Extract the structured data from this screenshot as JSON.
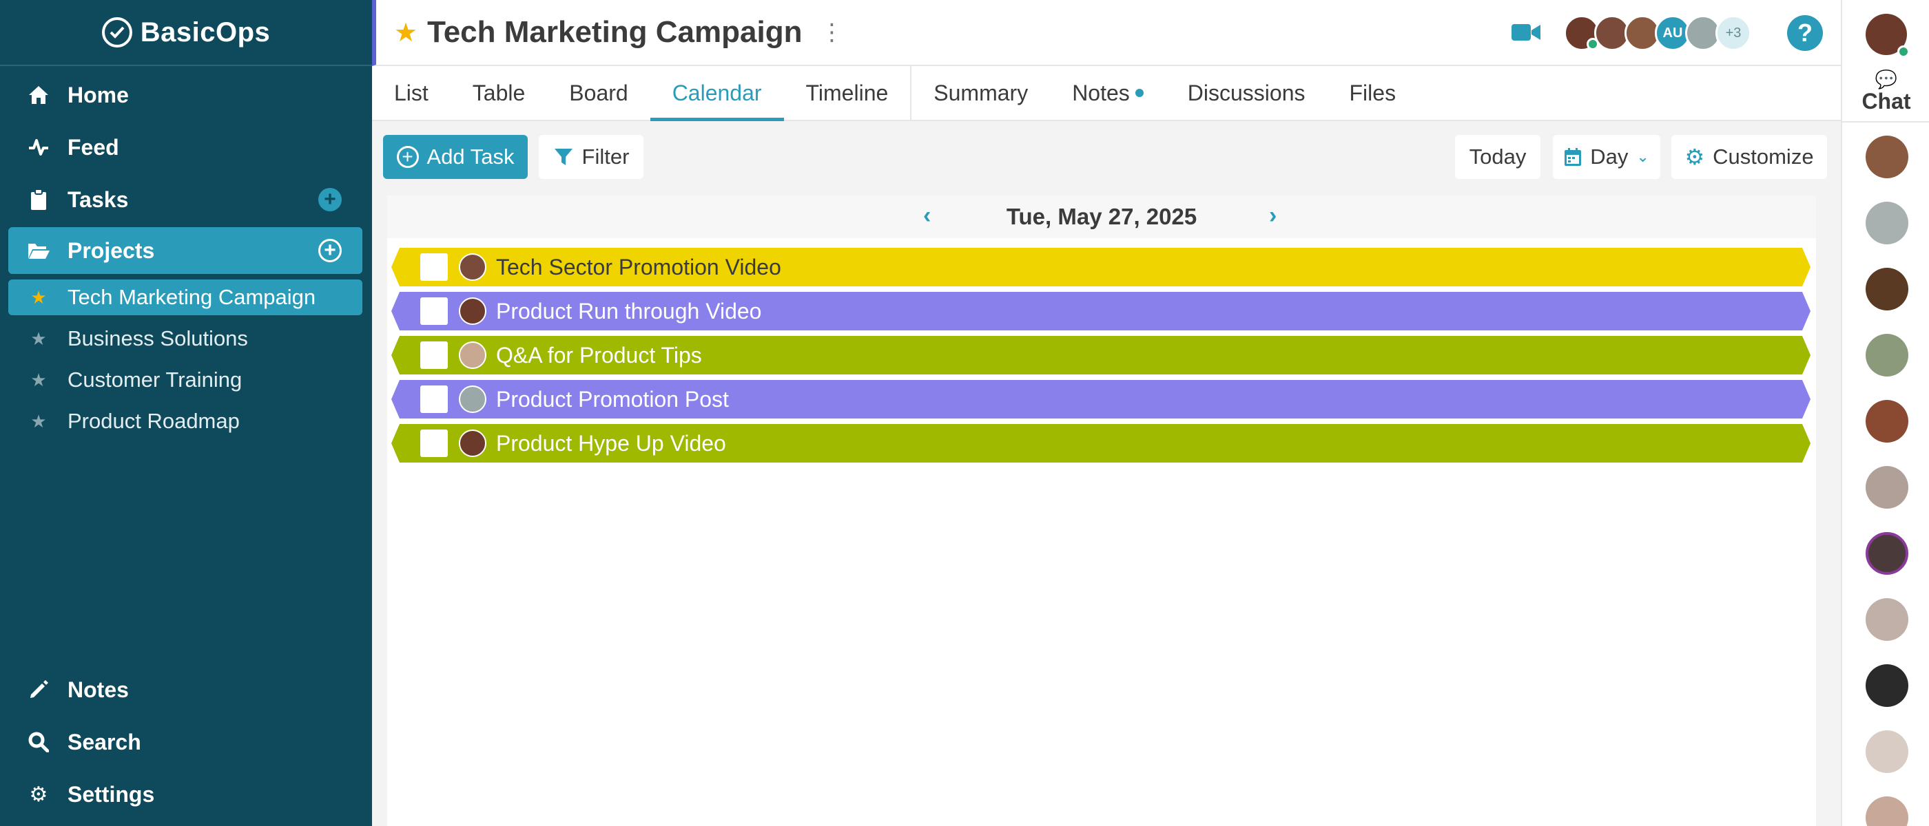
{
  "app": {
    "name": "BasicOps"
  },
  "sidebar": {
    "nav": [
      {
        "label": "Home",
        "icon": "home-icon"
      },
      {
        "label": "Feed",
        "icon": "activity-icon"
      },
      {
        "label": "Tasks",
        "icon": "clipboard-icon"
      },
      {
        "label": "Projects",
        "icon": "folder-open-icon"
      }
    ],
    "projects": [
      {
        "label": "Tech Marketing Campaign",
        "active": true
      },
      {
        "label": "Business Solutions"
      },
      {
        "label": "Customer Training"
      },
      {
        "label": "Product Roadmap"
      }
    ],
    "bottom": [
      {
        "label": "Notes",
        "icon": "pencil-icon"
      },
      {
        "label": "Search",
        "icon": "search-icon"
      },
      {
        "label": "Settings",
        "icon": "gear-icon"
      }
    ]
  },
  "header": {
    "title": "Tech Marketing Campaign",
    "avatar_initials": "AU",
    "more_count": "+3"
  },
  "tabs": [
    {
      "label": "List"
    },
    {
      "label": "Table"
    },
    {
      "label": "Board"
    },
    {
      "label": "Calendar",
      "active": true
    },
    {
      "label": "Timeline"
    },
    {
      "label": "Summary"
    },
    {
      "label": "Notes"
    },
    {
      "label": "Discussions"
    },
    {
      "label": "Files"
    }
  ],
  "toolbar": {
    "add_task": "Add Task",
    "filter": "Filter",
    "today": "Today",
    "view": "Day",
    "customize": "Customize"
  },
  "calendar": {
    "date": "Tue, May 27, 2025",
    "tasks": [
      {
        "name": "Tech Sector Promotion Video",
        "color": "#f0d400"
      },
      {
        "name": "Product Run through Video",
        "color": "#8a80ec"
      },
      {
        "name": "Q&A for Product Tips",
        "color": "#9fb800"
      },
      {
        "name": "Product Promotion Post",
        "color": "#8a80ec"
      },
      {
        "name": "Product Hype Up Video",
        "color": "#9fb800"
      }
    ]
  },
  "chat": {
    "label": "Chat"
  },
  "colors": {
    "sidebar": "#0f4a5c",
    "accent": "#2a9cba",
    "star": "#f5b400"
  }
}
